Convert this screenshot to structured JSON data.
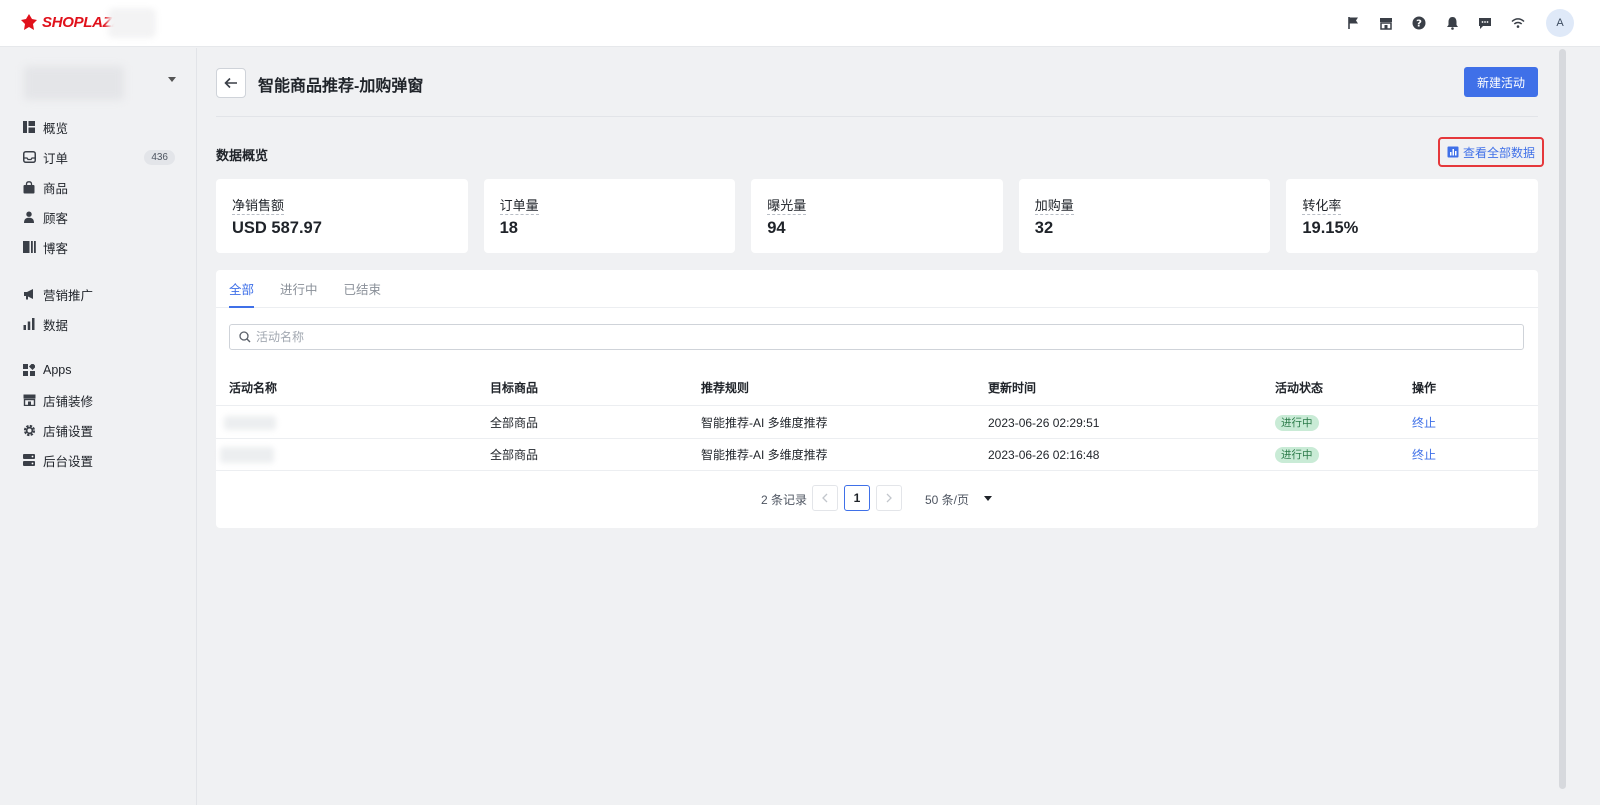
{
  "brand": {
    "name": "SHOPLAZZA",
    "color": "#e0111b"
  },
  "topbar": {
    "icons": [
      "flag-icon",
      "store-icon",
      "help-icon",
      "bell-icon",
      "message-icon",
      "wifi-icon"
    ],
    "avatar_initial": "A"
  },
  "sidebar": {
    "items": [
      {
        "label": "概览",
        "icon": "overview-icon"
      },
      {
        "label": "订单",
        "icon": "inbox-icon",
        "badge": "436"
      },
      {
        "label": "商品",
        "icon": "bag-icon"
      },
      {
        "label": "顾客",
        "icon": "person-icon"
      },
      {
        "label": "博客",
        "icon": "blog-icon"
      },
      {
        "label": "营销推广",
        "icon": "megaphone-icon"
      },
      {
        "label": "数据",
        "icon": "bar-chart-icon"
      },
      {
        "label": "Apps",
        "icon": "apps-icon"
      },
      {
        "label": "店铺装修",
        "icon": "store-icon"
      },
      {
        "label": "店铺设置",
        "icon": "gear-icon"
      },
      {
        "label": "后台设置",
        "icon": "server-icon"
      }
    ]
  },
  "header": {
    "title": "智能商品推荐-加购弹窗",
    "new_button": "新建活动"
  },
  "overview": {
    "title": "数据概览",
    "view_all": "查看全部数据",
    "stats": [
      {
        "label": "净销售额",
        "value": "USD 587.97"
      },
      {
        "label": "订单量",
        "value": "18"
      },
      {
        "label": "曝光量",
        "value": "94"
      },
      {
        "label": "加购量",
        "value": "32"
      },
      {
        "label": "转化率",
        "value": "19.15%"
      }
    ]
  },
  "tabs": [
    "全部",
    "进行中",
    "已结束"
  ],
  "search": {
    "placeholder": "活动名称"
  },
  "table": {
    "headers": [
      "活动名称",
      "目标商品",
      "推荐规则",
      "更新时间",
      "活动状态",
      "操作"
    ],
    "rows": [
      {
        "target": "全部商品",
        "rule": "智能推荐-AI 多维度推荐",
        "updated": "2023-06-26 02:29:51",
        "status": "进行中",
        "action": "终止"
      },
      {
        "target": "全部商品",
        "rule": "智能推荐-AI 多维度推荐",
        "updated": "2023-06-26 02:16:48",
        "status": "进行中",
        "action": "终止"
      }
    ]
  },
  "pagination": {
    "total": "2 条记录",
    "current": "1",
    "page_size": "50 条/页"
  },
  "colors": {
    "accent": "#3f70e8",
    "status_bg": "#c9ebd6",
    "highlight_border": "#e5383b"
  }
}
